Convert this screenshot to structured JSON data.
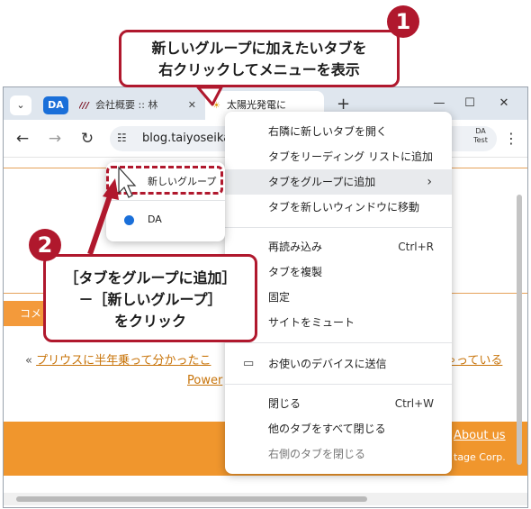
{
  "annotations": {
    "badge1": "1",
    "callout1_line1": "新しいグループに加えたいタブを",
    "callout1_line2": "右クリックしてメニューを表示",
    "badge2": "2",
    "callout2_line1": "［タブをグループに追加］",
    "callout2_line2": "－［新しいグループ］",
    "callout2_line3": "をクリック",
    "accent_color": "#b0182d"
  },
  "tabstrip": {
    "search_icon": "chevron-down-icon",
    "group_label": "DA",
    "group_color": "#1a6fd9",
    "tabs": [
      {
        "title": "会社概要 :: 林",
        "favicon": "company-logo-icon"
      },
      {
        "title": "太陽光発電に",
        "favicon": "sun-icon"
      }
    ],
    "close_glyph": "✕",
    "new_tab_glyph": "+"
  },
  "toolbar": {
    "url": "blog.taiyoseika",
    "profile_line1": "DA",
    "profile_line2": "Test"
  },
  "context_menu": {
    "sections": [
      [
        {
          "label": "右隣に新しいタブを開く"
        },
        {
          "label": "タブをリーディング リストに追加"
        },
        {
          "label": "タブをグループに追加",
          "has_submenu": true
        },
        {
          "label": "タブを新しいウィンドウに移動"
        }
      ],
      [
        {
          "label": "再読み込み",
          "shortcut": "Ctrl+R"
        },
        {
          "label": "タブを複製"
        },
        {
          "label": "固定"
        },
        {
          "label": "サイトをミュート"
        }
      ],
      [
        {
          "label": "お使いのデバイスに送信",
          "icon": "laptop-icon"
        }
      ],
      [
        {
          "label": "閉じる",
          "shortcut": "Ctrl+W"
        },
        {
          "label": "他のタブをすべて閉じる"
        },
        {
          "label": "右側のタブを閉じる"
        }
      ]
    ]
  },
  "group_submenu": {
    "new_group": "新しいグループ",
    "existing_group": "DA",
    "existing_group_color": "#1a6fd9"
  },
  "page": {
    "orange_strip_text": "コメ",
    "prev_arrow": "«",
    "prev_link": "プリウスに半年乗って分かったこ",
    "next_link": "ゃっている",
    "power_link": "Power",
    "footer_link": "About us",
    "footer_copy": "tage Corp.",
    "accent": "#f0962d"
  }
}
